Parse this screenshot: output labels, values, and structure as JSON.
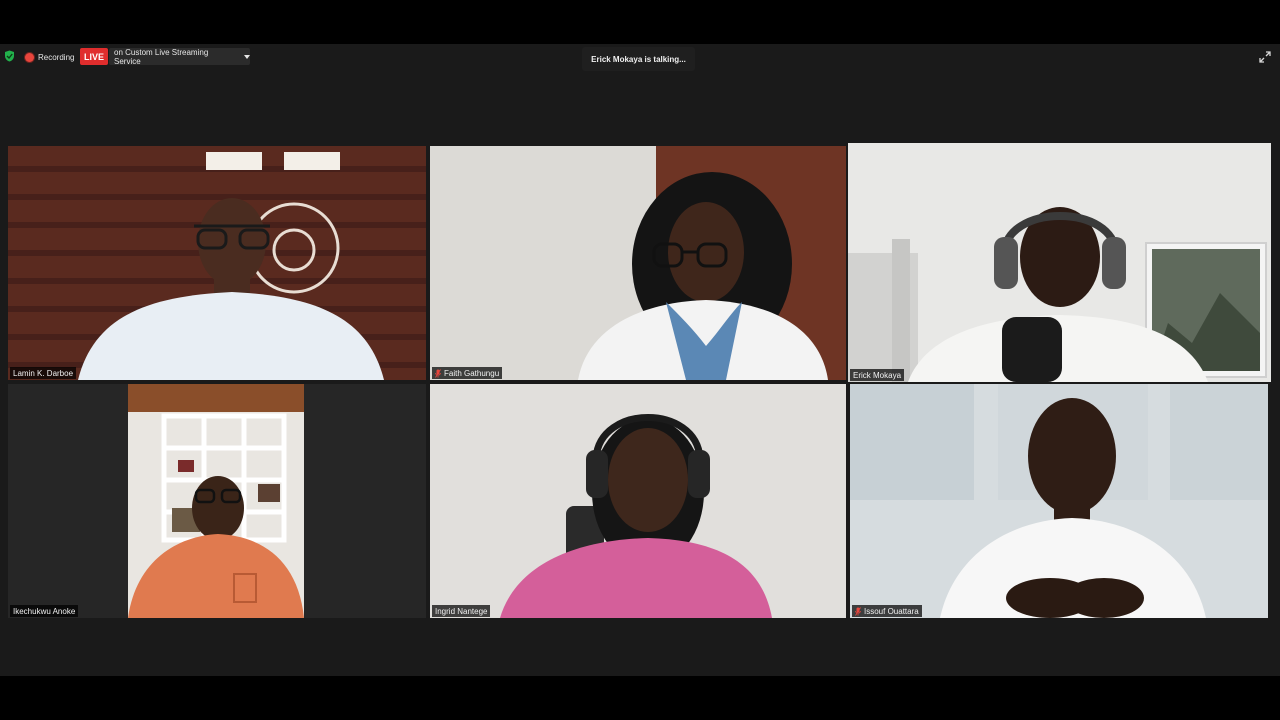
{
  "meeting": {
    "recording_label": "Recording",
    "live_label": "LIVE",
    "stream_label": "on Custom Live Streaming Service",
    "talking_status": "Erick Mokaya is talking..."
  },
  "participants": [
    {
      "name": "Lamin K. Darboe",
      "muted": false
    },
    {
      "name": "Faith Gathungu",
      "muted": true
    },
    {
      "name": "Erick Mokaya",
      "muted": false,
      "active_speaker": true
    },
    {
      "name": "Ikechukwu Anoke",
      "muted": false
    },
    {
      "name": "Ingrid Nantege",
      "muted": false
    },
    {
      "name": "Issouf Ouattara",
      "muted": true
    }
  ],
  "colors": {
    "live_red": "#e02d2d",
    "active_speaker_border": "#c4db6b",
    "muted_red": "#e8453c"
  },
  "icons": [
    "shield-check-icon",
    "record-icon",
    "dropdown-arrow-icon",
    "expand-icon",
    "mic-muted-icon"
  ]
}
